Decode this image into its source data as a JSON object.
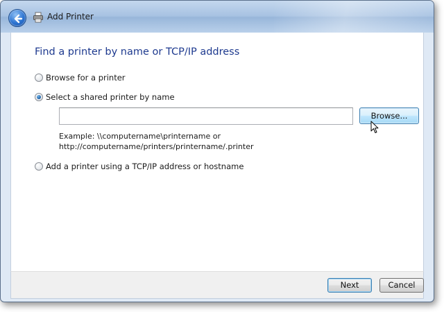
{
  "window": {
    "title": "Add Printer"
  },
  "icons": {
    "back": "back-arrow-icon",
    "printer": "printer-icon",
    "cursor": "mouse-pointer-icon"
  },
  "main": {
    "heading": "Find a printer by name or TCP/IP address",
    "options": [
      {
        "label": "Browse for a printer",
        "checked": false
      },
      {
        "label": "Select a shared printer by name",
        "checked": true
      },
      {
        "label": "Add a printer using a TCP/IP address or hostname",
        "checked": false
      }
    ],
    "shared_name_input": {
      "value": "",
      "placeholder": ""
    },
    "browse_label": "Browse...",
    "example_line1": "Example: \\\\computername\\printername or",
    "example_line2": "http://computername/printers/printername/.printer"
  },
  "footer": {
    "next_label": "Next",
    "cancel_label": "Cancel"
  },
  "colors": {
    "heading": "#1e3a8f",
    "accent": "#3c7fb1"
  }
}
